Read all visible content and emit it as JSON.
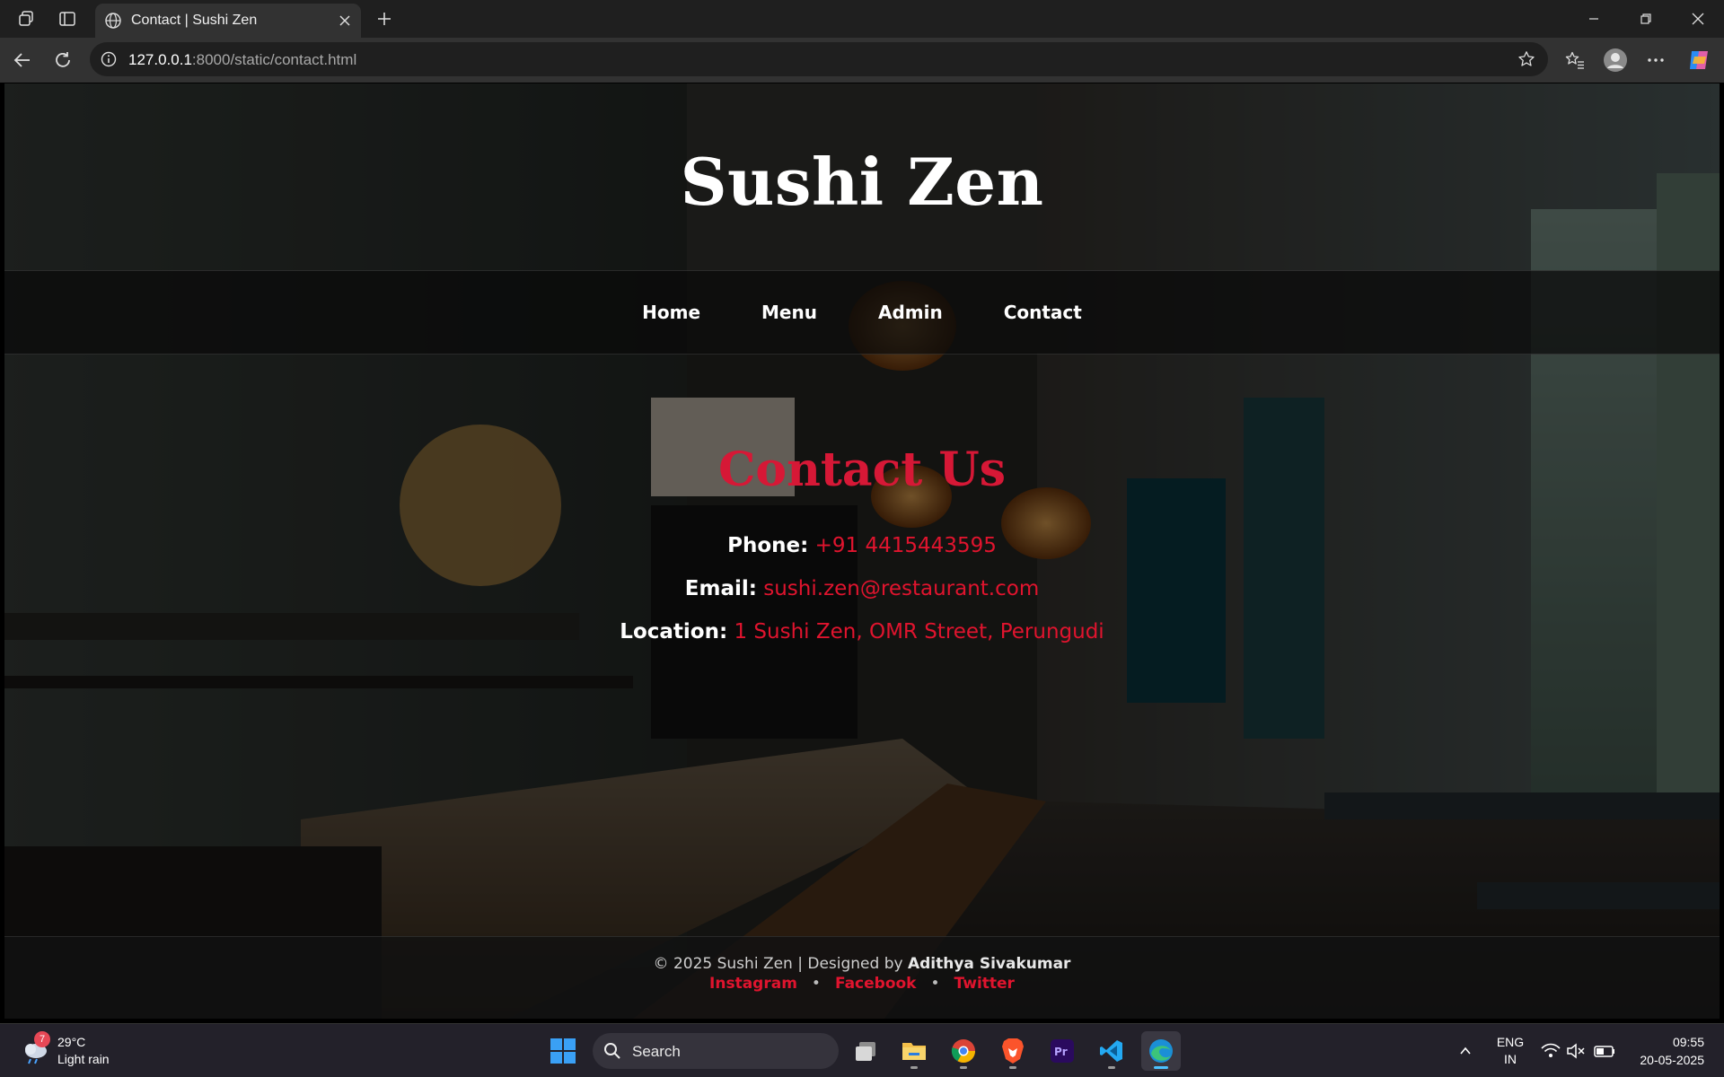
{
  "browser": {
    "tab_title": "Contact | Sushi Zen",
    "url_host": "127.0.0.1",
    "url_rest": ":8000/static/contact.html"
  },
  "site": {
    "title": "Sushi Zen",
    "nav": [
      "Home",
      "Menu",
      "Admin",
      "Contact"
    ]
  },
  "contact": {
    "heading": "Contact Us",
    "phone_label": "Phone:",
    "phone_value": "+91 4415443595",
    "email_label": "Email:",
    "email_value": "sushi.zen@restaurant.com",
    "location_label": "Location:",
    "location_value": "1 Sushi Zen, OMR Street, Perungudi"
  },
  "footer": {
    "copyright": "© 2025 Sushi Zen | Designed by",
    "designer": "Adithya Sivakumar",
    "links": [
      "Instagram",
      "Facebook",
      "Twitter"
    ],
    "separator": "•"
  },
  "taskbar": {
    "weather_temp": "29°C",
    "weather_desc": "Light rain",
    "weather_badge": "7",
    "search_placeholder": "Search",
    "lang_line1": "ENG",
    "lang_line2": "IN",
    "time": "09:55",
    "date": "20-05-2025"
  },
  "colors": {
    "accent": "#e0142e",
    "heading_red": "#d61836"
  }
}
